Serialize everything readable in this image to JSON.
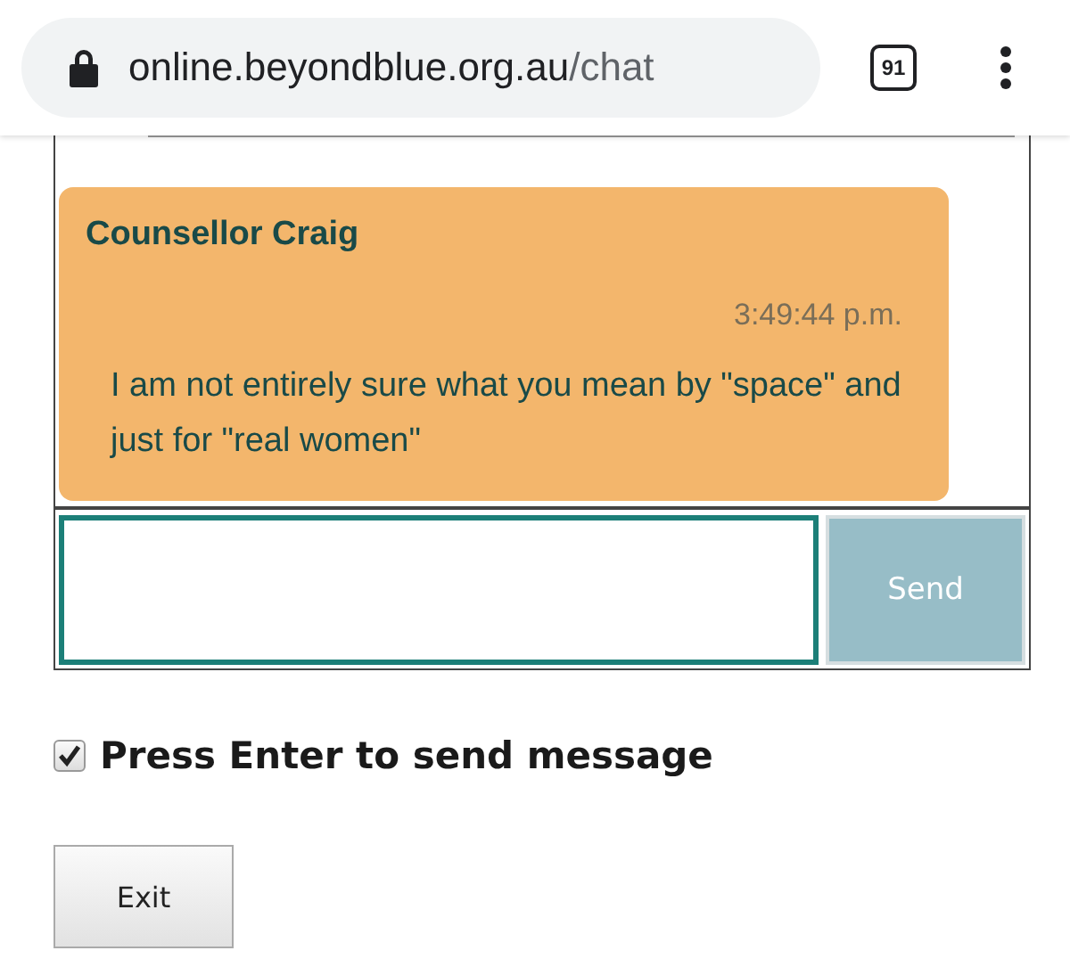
{
  "browser": {
    "url_domain": "online.beyondblue.org.au",
    "url_path": "/chat",
    "tab_count": "91"
  },
  "chat": {
    "messages": [
      {
        "sender": "Counsellor Craig",
        "time": "3:49:44 p.m.",
        "text": "I am not entirely sure what you mean by \"space\" and just for \"real women\""
      }
    ],
    "send_button": "Send"
  },
  "enter_to_send": {
    "label": "Press Enter to send message",
    "checked": true
  },
  "exit_button": "Exit"
}
